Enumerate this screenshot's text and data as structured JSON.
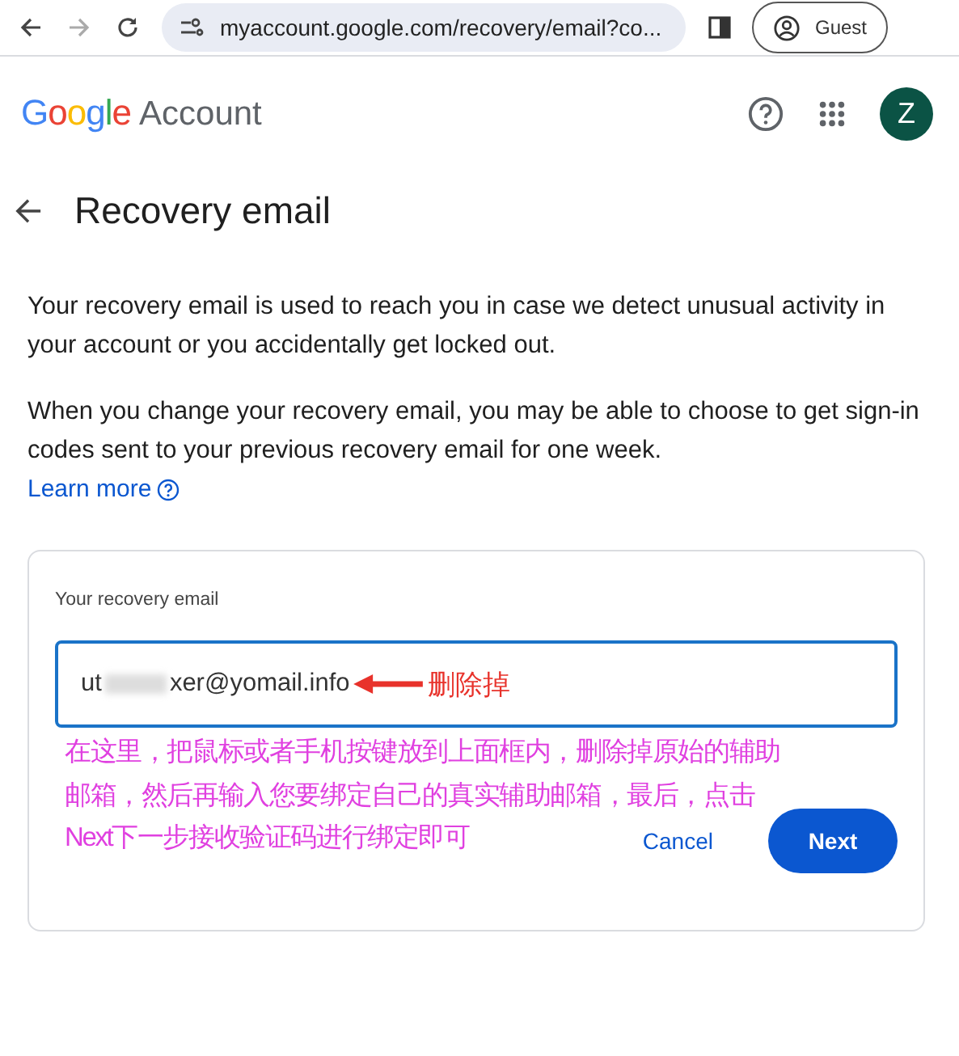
{
  "browser": {
    "url": "myaccount.google.com/recovery/email?co...",
    "profile": "Guest"
  },
  "header": {
    "logo": "Google",
    "product": "Account",
    "avatar": "Z"
  },
  "page": {
    "title": "Recovery email",
    "paragraphs": [
      "Your recovery email is used to reach you in case we detect unusual activity in your account or you accidentally get locked out.",
      "When you change your recovery email, you may be able to choose to get sign-in codes sent to your previous recovery email for one week."
    ],
    "learn_more": "Learn more"
  },
  "card": {
    "label": "Your recovery email",
    "value_start": "ut",
    "value_end": "xer@yomail.info",
    "buttons": [
      {
        "label": "Cancel",
        "kind": "text"
      },
      {
        "label": "Next",
        "kind": "filled"
      }
    ]
  },
  "annotations": {
    "arrow_note": "删除掉",
    "instruction_lines": [
      "在这里，把鼠标或者手机按键放到上面框内，删除掉原始的辅助",
      "邮箱，然后再输入您要绑定自己的真实辅助邮箱，最后，点击",
      "Next下一步接收验证码进行绑定即可"
    ]
  }
}
